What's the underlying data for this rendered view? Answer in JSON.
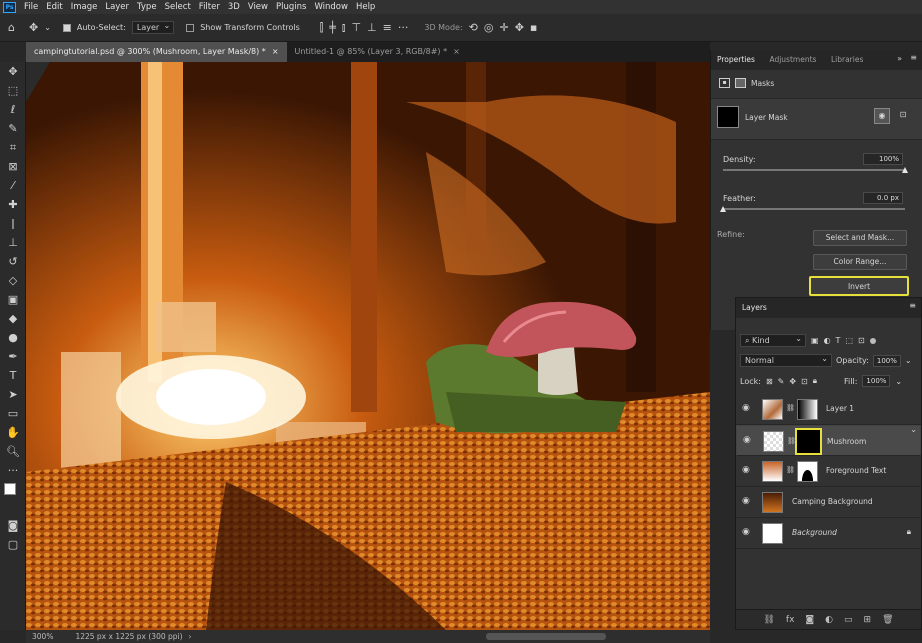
{
  "app": {
    "logo": "Ps"
  },
  "menu": [
    "File",
    "Edit",
    "Image",
    "Layer",
    "Type",
    "Select",
    "Filter",
    "3D",
    "View",
    "Plugins",
    "Window",
    "Help"
  ],
  "options": {
    "auto_select_label": "Auto-Select:",
    "auto_select_value": "Layer",
    "transform_label": "Show Transform Controls",
    "mode3d_label": "3D Mode:"
  },
  "tabs": [
    {
      "label": "campingtutorial.psd @ 300% (Mushroom, Layer Mask/8) *",
      "close": "×"
    },
    {
      "label": "Untitled-1 @ 85% (Layer 3, RGB/8#) *",
      "close": "×"
    }
  ],
  "status": {
    "zoom": "300%",
    "doc": "1225 px x 1225 px (300 ppi)"
  },
  "properties": {
    "tabs": [
      "Properties",
      "Adjustments",
      "Libraries"
    ],
    "section": "Masks",
    "mask_label": "Layer Mask",
    "density_label": "Density:",
    "density_value": "100%",
    "density_level": 1.0,
    "feather_label": "Feather:",
    "feather_value": "0.0 px",
    "feather_level": 0.0,
    "refine_label": "Refine:",
    "btn_select_mask": "Select and Mask...",
    "btn_color_range": "Color Range...",
    "btn_invert": "Invert"
  },
  "layers_panel": {
    "title": "Layers",
    "kind_label": "Kind",
    "blend_mode": "Normal",
    "opacity_label": "Opacity:",
    "opacity_value": "100%",
    "lock_label": "Lock:",
    "fill_label": "Fill:",
    "fill_value": "100%",
    "layers": [
      {
        "name": "Layer 1"
      },
      {
        "name": "Mushroom"
      },
      {
        "name": "Foreground Text"
      },
      {
        "name": "Camping Background"
      },
      {
        "name": "Background"
      }
    ]
  },
  "colors": {
    "highlight": "#e8e03a",
    "accent": "#31a8ff"
  }
}
